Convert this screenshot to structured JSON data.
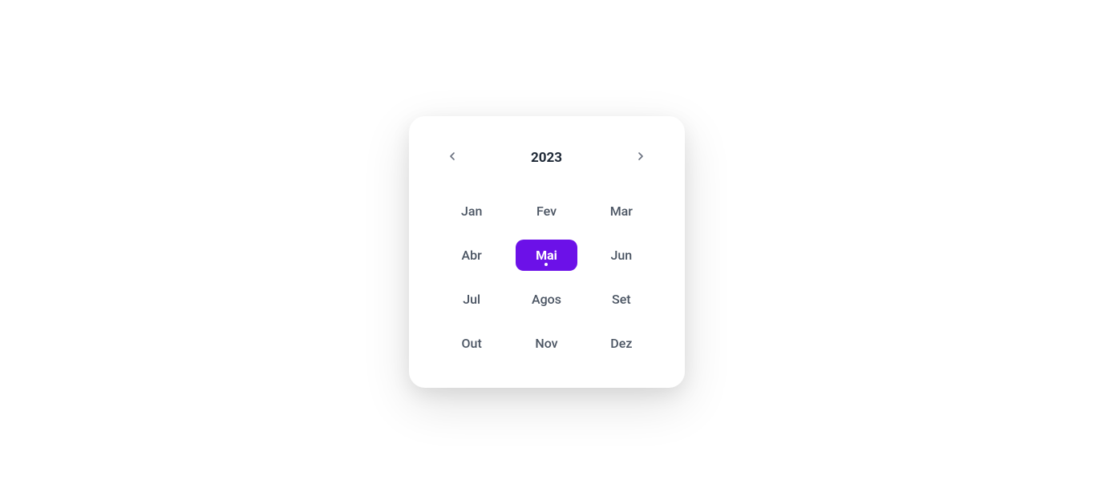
{
  "picker": {
    "year": "2023",
    "selectedIndex": 4,
    "months": [
      {
        "label": "Jan"
      },
      {
        "label": "Fev"
      },
      {
        "label": "Mar"
      },
      {
        "label": "Abr"
      },
      {
        "label": "Mai"
      },
      {
        "label": "Jun"
      },
      {
        "label": "Jul"
      },
      {
        "label": "Agos"
      },
      {
        "label": "Set"
      },
      {
        "label": "Out"
      },
      {
        "label": "Nov"
      },
      {
        "label": "Dez"
      }
    ]
  }
}
